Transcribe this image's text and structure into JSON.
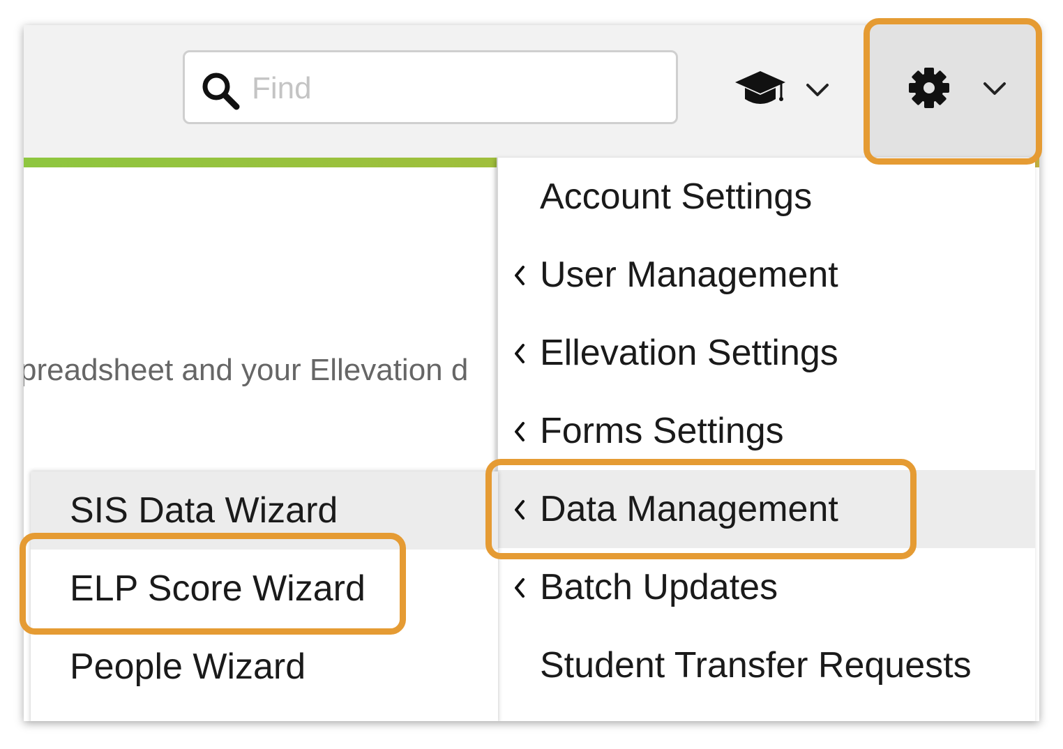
{
  "search": {
    "placeholder": "Find"
  },
  "header": {
    "graduation_menu_icon": "graduation-cap-icon",
    "settings_menu_icon": "gear-icon"
  },
  "background": {
    "partial_text": "preadsheet and your Ellevation d"
  },
  "settings_menu": {
    "items": [
      {
        "label": "Account Settings",
        "has_submenu": false
      },
      {
        "label": "User Management",
        "has_submenu": true
      },
      {
        "label": "Ellevation Settings",
        "has_submenu": true
      },
      {
        "label": "Forms Settings",
        "has_submenu": true
      },
      {
        "label": "Data Management",
        "has_submenu": true,
        "active": true
      },
      {
        "label": "Batch Updates",
        "has_submenu": true
      },
      {
        "label": "Student Transfer Requests",
        "has_submenu": false
      }
    ]
  },
  "data_management_submenu": {
    "items": [
      {
        "label": "SIS Data Wizard",
        "active": true
      },
      {
        "label": "ELP Score Wizard"
      },
      {
        "label": "People Wizard"
      }
    ]
  },
  "colors": {
    "highlight": "#e59b33",
    "accent_bar_start": "#8ec63f",
    "accent_bar_end": "#c3b040",
    "header_bg": "#f2f2f2",
    "active_row_bg": "#ececec"
  }
}
